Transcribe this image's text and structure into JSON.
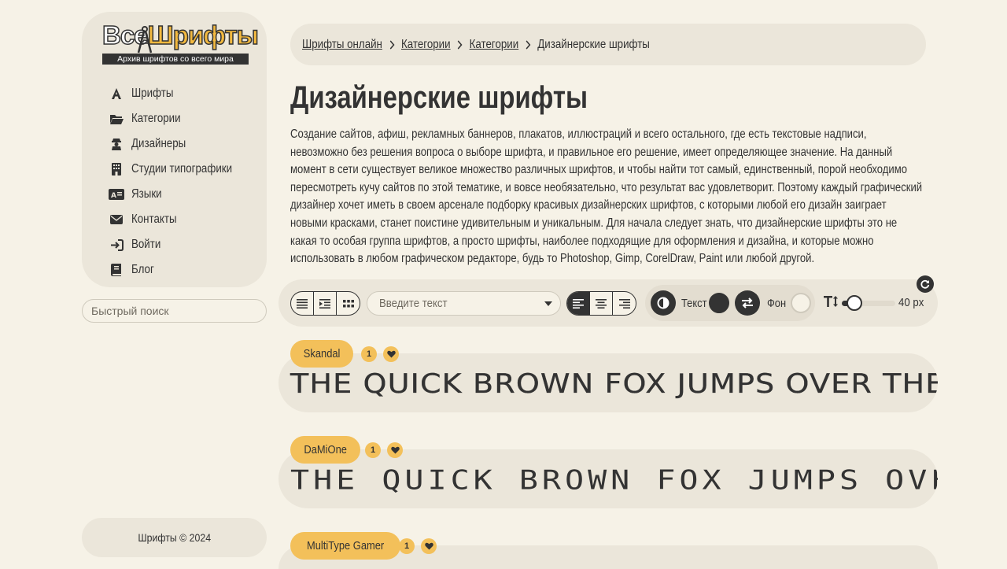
{
  "logo": {
    "part1": "Все",
    "part2": "Шрифты",
    "tagline": "Архив шрифтов со всего мира"
  },
  "nav": [
    {
      "label": "Шрифты",
      "icon": "font-icon"
    },
    {
      "label": "Категории",
      "icon": "folder-icon"
    },
    {
      "label": "Дизайнеры",
      "icon": "designer-icon"
    },
    {
      "label": "Студии типографики",
      "icon": "building-icon"
    },
    {
      "label": "Языки",
      "icon": "language-icon"
    },
    {
      "label": "Контакты",
      "icon": "envelope-icon"
    },
    {
      "label": "Войти",
      "icon": "login-icon"
    },
    {
      "label": "Блог",
      "icon": "book-icon"
    }
  ],
  "quick_search": {
    "placeholder": "Быстрый поиск"
  },
  "footer": {
    "text": "Шрифты © 2024"
  },
  "breadcrumb": [
    {
      "label": "Шрифты онлайн",
      "link": true
    },
    {
      "label": "Категории",
      "link": true
    },
    {
      "label": "Категории",
      "link": true
    },
    {
      "label": "Дизайнерские шрифты",
      "link": false
    }
  ],
  "page": {
    "title": "Дизайнерские шрифты",
    "description": "Создание сайтов, афиш, рекламных баннеров, плакатов, иллюстраций и всего остального, где есть текстовые надписи, невозможно без решения вопроса о выборе шрифта, и правильное его решение, имеет определяющее значение. На данный момент в сети существует великое множество различных шрифтов, и чтобы найти тот самый, единственный, порой необходимо пересмотреть кучу сайтов по этой тематике, и вовсе необязательно, что результат вас удовлетворит. Поэтому каждый графический дизайнер хочет иметь в своем арсенале подборку красивых дизайнерских шрифтов, с которыми любой его дизайн заиграет новыми красками, станет поистине удивительным и уникальным. Для начала следует знать, что дизайнерские шрифты это не какая то особая группа шрифтов, а просто шрифты, наиболее подходящие для оформления и дизайна, и которые можно использовать в любом графическом редакторе, будь то Photoshop, Gimp, CorelDraw, Paint или любой другой."
  },
  "toolbar": {
    "text_placeholder": "Введите текст",
    "text_label": "Текст",
    "bg_label": "Фон",
    "text_color": "#333333",
    "bg_color": "#f6f2e7",
    "size_value": "40",
    "size_unit": "px",
    "size_fraction": 0.15
  },
  "fonts": [
    {
      "name": "Skandal",
      "count": "1",
      "preview": "THE QUICK BROWN FOX JUMPS OVER THE LAZY DOG"
    },
    {
      "name": "DaMiOne",
      "count": "1",
      "preview": "THE QUICK BROWN FOX JUMPS OVER THE LAZY DOG"
    },
    {
      "name": "MultiType Gamer",
      "count": "1",
      "preview": ""
    }
  ],
  "colors": {
    "background": "#f6f2e7",
    "panel": "#ebe6da",
    "accent": "#f3c05a",
    "ink": "#333333"
  }
}
